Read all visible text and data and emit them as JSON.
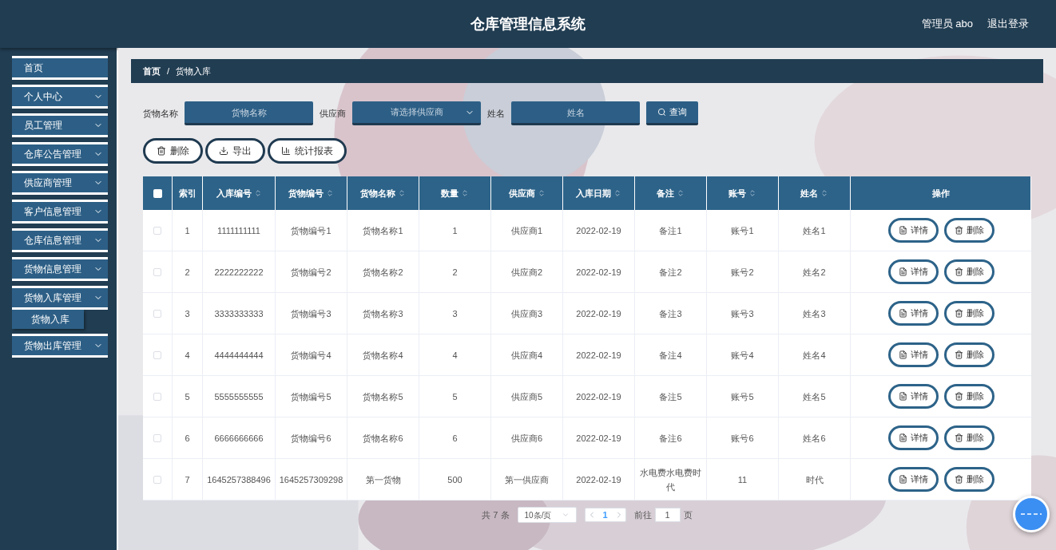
{
  "header": {
    "title": "仓库管理信息系统",
    "user": "管理员 abo",
    "logout": "退出登录"
  },
  "sidebar": {
    "items": [
      {
        "label": "首页",
        "expandable": false
      },
      {
        "label": "个人中心",
        "expandable": true,
        "expanded": false
      },
      {
        "label": "员工管理",
        "expandable": true,
        "expanded": false
      },
      {
        "label": "仓库公告管理",
        "expandable": true,
        "expanded": false
      },
      {
        "label": "供应商管理",
        "expandable": true,
        "expanded": false
      },
      {
        "label": "客户信息管理",
        "expandable": true,
        "expanded": false
      },
      {
        "label": "仓库信息管理",
        "expandable": true,
        "expanded": false
      },
      {
        "label": "货物信息管理",
        "expandable": true,
        "expanded": false
      },
      {
        "label": "货物入库管理",
        "expandable": true,
        "expanded": true,
        "children": [
          {
            "label": "货物入库",
            "selected": true
          }
        ]
      },
      {
        "label": "货物出库管理",
        "expandable": true,
        "expanded": false
      }
    ]
  },
  "breadcrumb": {
    "items": [
      "首页",
      "货物入库"
    ],
    "separator": "/"
  },
  "search": {
    "fields": [
      {
        "kind": "input",
        "label": "货物名称",
        "placeholder": "货物名称"
      },
      {
        "kind": "select",
        "label": "供应商",
        "placeholder": "请选择供应商"
      },
      {
        "kind": "input",
        "label": "姓名",
        "placeholder": "姓名"
      }
    ],
    "button": "查询"
  },
  "actions": [
    {
      "kind": "delete",
      "label": "删除"
    },
    {
      "kind": "export",
      "label": "导出"
    },
    {
      "kind": "chart",
      "label": "统计报表"
    }
  ],
  "table": {
    "all_checked": false,
    "columns": [
      {
        "label": "索引",
        "sortable": false
      },
      {
        "label": "入库编号",
        "sortable": true
      },
      {
        "label": "货物编号",
        "sortable": true
      },
      {
        "label": "货物名称",
        "sortable": true
      },
      {
        "label": "数量",
        "sortable": true
      },
      {
        "label": "供应商",
        "sortable": true
      },
      {
        "label": "入库日期",
        "sortable": true
      },
      {
        "label": "备注",
        "sortable": true
      },
      {
        "label": "账号",
        "sortable": true
      },
      {
        "label": "姓名",
        "sortable": true
      },
      {
        "label": "操作",
        "sortable": false
      }
    ],
    "rows": [
      {
        "checked": false,
        "cells": [
          "1",
          "1111111111",
          "货物编号1",
          "货物名称1",
          "1",
          "供应商1",
          "2022-02-19",
          "备注1",
          "账号1",
          "姓名1"
        ],
        "buttons": [
          "详情",
          "删除"
        ]
      },
      {
        "checked": false,
        "cells": [
          "2",
          "2222222222",
          "货物编号2",
          "货物名称2",
          "2",
          "供应商2",
          "2022-02-19",
          "备注2",
          "账号2",
          "姓名2"
        ],
        "buttons": [
          "详情",
          "删除"
        ]
      },
      {
        "checked": false,
        "cells": [
          "3",
          "3333333333",
          "货物编号3",
          "货物名称3",
          "3",
          "供应商3",
          "2022-02-19",
          "备注3",
          "账号3",
          "姓名3"
        ],
        "buttons": [
          "详情",
          "删除"
        ]
      },
      {
        "checked": false,
        "cells": [
          "4",
          "4444444444",
          "货物编号4",
          "货物名称4",
          "4",
          "供应商4",
          "2022-02-19",
          "备注4",
          "账号4",
          "姓名4"
        ],
        "buttons": [
          "详情",
          "删除"
        ]
      },
      {
        "checked": false,
        "cells": [
          "5",
          "5555555555",
          "货物编号5",
          "货物名称5",
          "5",
          "供应商5",
          "2022-02-19",
          "备注5",
          "账号5",
          "姓名5"
        ],
        "buttons": [
          "详情",
          "删除"
        ]
      },
      {
        "checked": false,
        "cells": [
          "6",
          "6666666666",
          "货物编号6",
          "货物名称6",
          "6",
          "供应商6",
          "2022-02-19",
          "备注6",
          "账号6",
          "姓名6"
        ],
        "buttons": [
          "详情",
          "删除"
        ]
      },
      {
        "checked": false,
        "cells": [
          "7",
          "1645257388496",
          "1645257309298",
          "第一货物",
          "500",
          "第一供应商",
          "2022-02-19",
          "水电费水电费时代",
          "11",
          "时代"
        ],
        "buttons": [
          "详情",
          "删除"
        ]
      }
    ]
  },
  "pagination": {
    "total": "共 7 条",
    "page_size": "10条/页",
    "pages": [
      {
        "label": "1",
        "selected": true
      }
    ],
    "goto_label": "前往",
    "goto_value": "1",
    "goto_suffix": "页"
  }
}
